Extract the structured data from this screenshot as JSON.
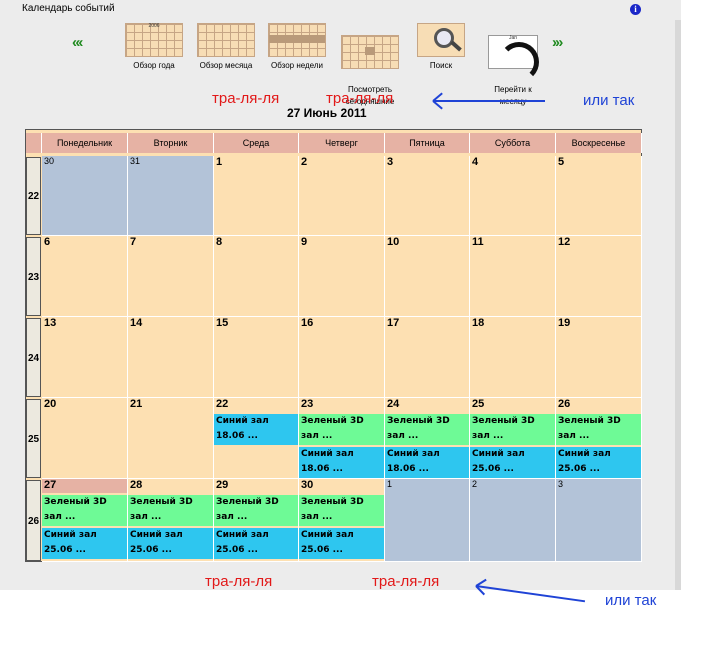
{
  "window": {
    "title": "Календарь событий",
    "info_icon": "i"
  },
  "nav": {
    "prev": "«‹",
    "next": "›»"
  },
  "toolbar": {
    "year_tag": "2006",
    "goto_tag": "Jan",
    "items": [
      {
        "label": "Обзор года",
        "icon": "year-grid-icon"
      },
      {
        "label": "Обзор месяца",
        "icon": "month-grid-icon"
      },
      {
        "label": "Обзор недели",
        "icon": "week-grid-icon"
      },
      {
        "label": "Посмотреть\nсегодняшние",
        "icon": "today-grid-icon"
      },
      {
        "label": "Поиск",
        "icon": "magnifier-icon"
      },
      {
        "label": "Перейти к\nмесяцу",
        "icon": "goto-month-icon"
      }
    ]
  },
  "annotations": {
    "top_left": "тра-ля-ля",
    "top_right": "тра-ля-ля",
    "top_side": "или так",
    "bottom_left": "тра-ля-ля",
    "bottom_right": "тра-ля-ля",
    "bottom_side": "или так",
    "arrow_color": "#1f43d6",
    "note_color": "#e21919"
  },
  "calendar": {
    "date_title": "27 Июнь 2011",
    "weekdays": [
      "Понедельник",
      "Вторник",
      "Среда",
      "Четверг",
      "Пятница",
      "Суббота",
      "Воскресенье"
    ],
    "weeks": [
      {
        "number": "22",
        "days": [
          {
            "day": "30",
            "other": true,
            "events": []
          },
          {
            "day": "31",
            "other": true,
            "events": []
          },
          {
            "day": "1",
            "events": []
          },
          {
            "day": "2",
            "events": []
          },
          {
            "day": "3",
            "events": []
          },
          {
            "day": "4",
            "events": []
          },
          {
            "day": "5",
            "events": []
          }
        ]
      },
      {
        "number": "23",
        "days": [
          {
            "day": "6",
            "events": []
          },
          {
            "day": "7",
            "events": []
          },
          {
            "day": "8",
            "events": []
          },
          {
            "day": "9",
            "events": []
          },
          {
            "day": "10",
            "events": []
          },
          {
            "day": "11",
            "events": []
          },
          {
            "day": "12",
            "events": []
          }
        ]
      },
      {
        "number": "24",
        "days": [
          {
            "day": "13",
            "events": []
          },
          {
            "day": "14",
            "events": []
          },
          {
            "day": "15",
            "events": []
          },
          {
            "day": "16",
            "events": []
          },
          {
            "day": "17",
            "events": []
          },
          {
            "day": "18",
            "events": []
          },
          {
            "day": "19",
            "events": []
          }
        ]
      },
      {
        "number": "25",
        "days": [
          {
            "day": "20",
            "events": []
          },
          {
            "day": "21",
            "events": []
          },
          {
            "day": "22",
            "events": [
              {
                "text": "Синий зал\n18.06 ...",
                "kind": "blue"
              }
            ]
          },
          {
            "day": "23",
            "events": [
              {
                "text": "Зеленый 3D\nзал ...",
                "kind": "green"
              },
              {
                "text": "Синий зал\n18.06 ...",
                "kind": "blue"
              }
            ]
          },
          {
            "day": "24",
            "events": [
              {
                "text": "Зеленый 3D\nзал ...",
                "kind": "green"
              },
              {
                "text": "Синий зал\n18.06 ...",
                "kind": "blue"
              }
            ]
          },
          {
            "day": "25",
            "events": [
              {
                "text": "Зеленый 3D\nзал ...",
                "kind": "green"
              },
              {
                "text": "Синий зал\n25.06 ...",
                "kind": "blue"
              }
            ]
          },
          {
            "day": "26",
            "events": [
              {
                "text": "Зеленый 3D\nзал ...",
                "kind": "green"
              },
              {
                "text": "Синий зал\n25.06 ...",
                "kind": "blue"
              }
            ]
          }
        ]
      },
      {
        "number": "26",
        "days": [
          {
            "day": "27",
            "today": true,
            "events": [
              {
                "text": "Зеленый 3D\nзал ...",
                "kind": "green"
              },
              {
                "text": "Синий зал\n25.06 ...",
                "kind": "blue"
              }
            ]
          },
          {
            "day": "28",
            "events": [
              {
                "text": "Зеленый 3D\nзал ...",
                "kind": "green"
              },
              {
                "text": "Синий зал\n25.06 ...",
                "kind": "blue"
              }
            ]
          },
          {
            "day": "29",
            "events": [
              {
                "text": "Зеленый 3D\nзал ...",
                "kind": "green"
              },
              {
                "text": "Синий зал\n25.06 ...",
                "kind": "blue"
              }
            ]
          },
          {
            "day": "30",
            "events": [
              {
                "text": "Зеленый 3D\nзал ...",
                "kind": "green"
              },
              {
                "text": "Синий зал\n25.06 ...",
                "kind": "blue"
              }
            ]
          },
          {
            "day": "1",
            "other": true,
            "events": []
          },
          {
            "day": "2",
            "other": true,
            "events": []
          },
          {
            "day": "3",
            "other": true,
            "events": []
          }
        ]
      }
    ]
  }
}
